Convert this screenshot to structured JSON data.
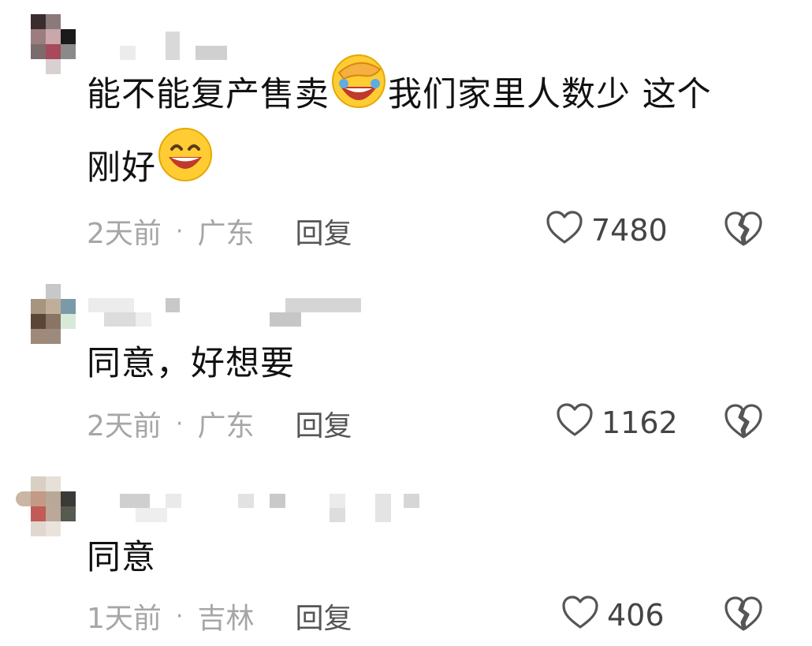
{
  "comments": [
    {
      "text_lines": [
        "能不能复产售卖",
        "我们家里人数少 这个",
        "刚好"
      ],
      "emojis": [
        "facepalm-laugh-emoji",
        "grin-emoji"
      ],
      "time": "2天前",
      "separator": "·",
      "location": "广东",
      "reply_label": "回复",
      "like_count": "7480",
      "icons": {
        "like": "heart-outline-icon",
        "dislike": "broken-heart-icon"
      }
    },
    {
      "text_lines": [
        "同意，好想要"
      ],
      "time": "2天前",
      "separator": "·",
      "location": "广东",
      "reply_label": "回复",
      "like_count": "1162",
      "icons": {
        "like": "heart-outline-icon",
        "dislike": "broken-heart-icon"
      }
    },
    {
      "text_lines": [
        "同意"
      ],
      "time": "1天前",
      "separator": "·",
      "location": "吉林",
      "reply_label": "回复",
      "like_count": "406",
      "icons": {
        "like": "heart-outline-icon",
        "dislike": "broken-heart-icon"
      }
    }
  ],
  "colors": {
    "text": "#111111",
    "meta": "#a6a6a6",
    "reply": "#555555",
    "icon": "#444444"
  }
}
